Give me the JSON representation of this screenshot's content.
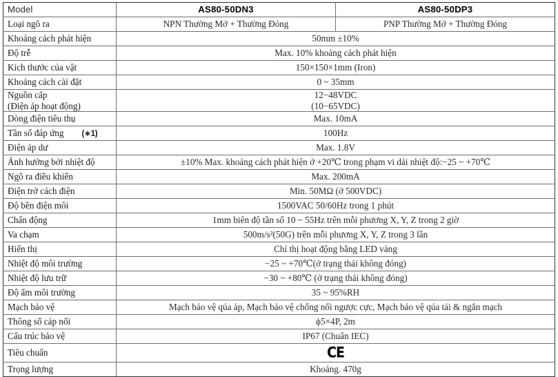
{
  "table": {
    "header": {
      "label": "Model",
      "model_1": "AS80-50DN3",
      "model_2": "AS80-50DP3"
    },
    "rows": [
      {
        "label": "Loại ngõ ra",
        "split": true,
        "value_1": "NPN Thường Mở + Thường Đóng",
        "value_2": "PNP Thường Mở + Thường Đóng"
      },
      {
        "label": "Khoảng cách phát hiện",
        "split": false,
        "value": "50mm  ±10%"
      },
      {
        "label": "Độ trễ",
        "split": false,
        "value": "Max. 10% khoảng cách phát hiện"
      },
      {
        "label": "Kích thước của vật",
        "split": false,
        "value": "150×150×1mm (Iron)"
      },
      {
        "label": "Khoảng cách cài đặt",
        "split": false,
        "value": "0 ~ 35mm"
      },
      {
        "label_line_1": "Nguồn cấp",
        "label_line_2": "(Điện áp hoạt động)",
        "split": false,
        "tall": true,
        "value_line_1": "12−48VDC",
        "value_line_2": "(10−65VDC)"
      },
      {
        "label": "Dòng điện tiêu thụ",
        "split": false,
        "value": "Max. 10mA"
      },
      {
        "label": "Tần số đáp ứng",
        "note": "(∗1)",
        "split": false,
        "value": "100Hz"
      },
      {
        "label": "Điện áp dư",
        "split": false,
        "value": "Max. 1.8V"
      },
      {
        "label": "Ảnh hưởng bởi nhiệt độ",
        "split": false,
        "value": "±10% Max. khoảng cách phát hiện ở +20℃ trong phạm vi dải nhiệt độ:−25 ~ +70℃"
      },
      {
        "label": "Ngõ ra điều khiển",
        "split": false,
        "value": "Max. 200mA"
      },
      {
        "label": "Điện trở cách điện",
        "split": false,
        "value": "Min. 50MΩ (ở 500VDC)"
      },
      {
        "label": "Độ bền điện môi",
        "split": false,
        "value": "1500VAC 50/60Hz trong 1 phút"
      },
      {
        "label": "Chấn động",
        "split": false,
        "value": "1mm biên độ tần số 10 ~ 55Hz trên mỗi phương X, Y, Z trong 2 giờ"
      },
      {
        "label": "Va chạm",
        "split": false,
        "value": "500m/s²(50G) trên mỗi phương X, Y, Z trong 3 lần"
      },
      {
        "label": "Hiển thị",
        "split": false,
        "value": "Chỉ thị hoạt động bằng LED vàng"
      },
      {
        "label": "Nhiệt độ môi trường",
        "split": false,
        "value": "−25 ~ +70℃(ở trạng thái không đóng)"
      },
      {
        "label": "Nhiệt độ lưu trữ",
        "split": false,
        "value": "−30 ~ +80℃ (ở trạng thái không đóng)"
      },
      {
        "label": "Độ ẩm môi trường",
        "split": false,
        "value": "35 ~ 95%RH"
      },
      {
        "label": "Mạch bảo vệ",
        "split": false,
        "value": "Mạch bảo vệ qúa áp, Mạch bảo vệ chống nối ngược cực, Mạch bảo vệ qúa tải & ngắn mạch"
      },
      {
        "label": "Thông số cáp nối",
        "split": false,
        "value": "ϕ5×4P, 2m"
      },
      {
        "label": "Cấu trúc bảo vệ",
        "split": false,
        "value": "IP67 (Chuẩn IEC)"
      },
      {
        "label": "Tiêu chuẩn",
        "split": false,
        "icon": "ce-mark-icon",
        "value": "CE"
      },
      {
        "label": "Trọng lượng",
        "split": false,
        "value": "Khoảng. 470g"
      }
    ]
  }
}
